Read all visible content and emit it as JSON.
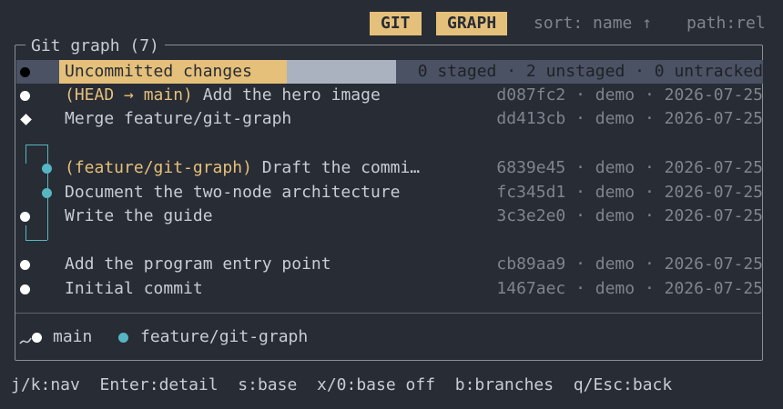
{
  "header": {
    "tag_git": "GIT",
    "tag_graph": "GRAPH",
    "sort": "sort: name ↑",
    "path": "path:rel"
  },
  "panel": {
    "title": "Git graph  (7)"
  },
  "rows": [
    {
      "subject": "Uncommitted changes",
      "meta": "0 staged · 2 unstaged · 0 untracked"
    },
    {
      "ref": "(HEAD → main)",
      "subject": " Add the hero image",
      "meta": "d087fc2 · demo · 2026-07-25"
    },
    {
      "subject": "Merge feature/git-graph",
      "meta": "dd413cb · demo · 2026-07-25"
    },
    {
      "ref": "(feature/git-graph)",
      "subject": " Draft the commi…",
      "meta": "6839e45 · demo · 2026-07-25"
    },
    {
      "subject": "Document the two-node architecture",
      "meta": "fc345d1 · demo · 2026-07-25"
    },
    {
      "subject": "Write the guide",
      "meta": "3c3e2e0 · demo · 2026-07-25"
    },
    {
      "subject": "Add the program entry point",
      "meta": "cb89aa9 · demo · 2026-07-25"
    },
    {
      "subject": "Initial commit",
      "meta": "1467aec · demo · 2026-07-25"
    }
  ],
  "legend": {
    "main": "main",
    "feature": "feature/git-graph"
  },
  "footer": {
    "nav": "j/k:nav",
    "detail": "Enter:detail",
    "base": "s:base",
    "base_off": "x/0:base off",
    "branches": "b:branches",
    "back": "q/Esc:back"
  },
  "colors": {
    "background": "#282c34",
    "accent": "#e5c07b",
    "branch": "#56b6c2",
    "dim": "#7f848e"
  }
}
